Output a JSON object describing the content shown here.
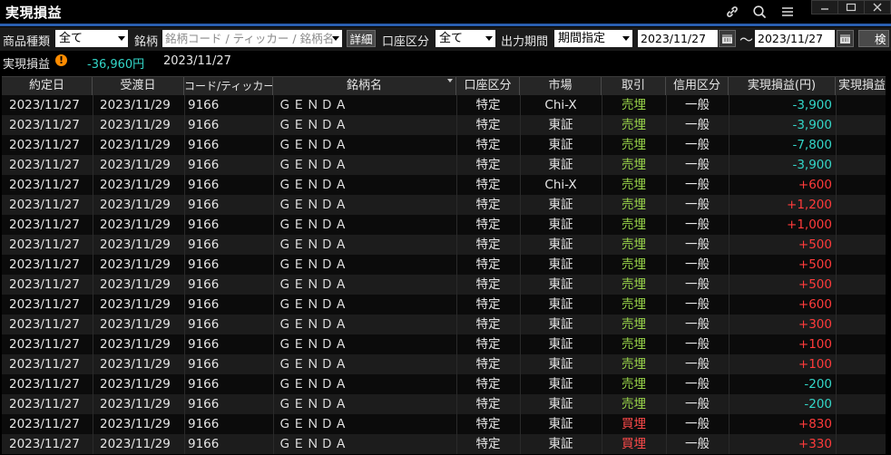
{
  "window": {
    "title": "実現損益"
  },
  "filters": {
    "product_type_label": "商品種類",
    "product_type_value": "全て",
    "symbol_label": "銘柄",
    "symbol_placeholder": "銘柄コード / ティッカー / 銘柄名",
    "detail_button": "詳細",
    "account_type_label": "口座区分",
    "account_type_value": "全て",
    "period_label": "出力期間",
    "period_value": "期間指定",
    "date_from": "2023/11/27",
    "date_sep": "〜",
    "date_to": "2023/11/27",
    "search_button": "検"
  },
  "summary": {
    "label": "実現損益",
    "warning_icon": "!",
    "value": "-36,960円",
    "date": "2023/11/27"
  },
  "table": {
    "columns": [
      "約定日",
      "受渡日",
      "コード/ティッカー",
      "銘柄名",
      "口座区分",
      "市場",
      "取引",
      "信用区分",
      "実現損益(円)",
      "実現損益"
    ],
    "rows": [
      {
        "trade_date": "2023/11/27",
        "settle_date": "2023/11/29",
        "code": "9166",
        "name": "ＧＥＮＤＡ",
        "account": "特定",
        "market": "Chi-X",
        "trade": "売埋",
        "margin": "一般",
        "pnl": "-3,900"
      },
      {
        "trade_date": "2023/11/27",
        "settle_date": "2023/11/29",
        "code": "9166",
        "name": "ＧＥＮＤＡ",
        "account": "特定",
        "market": "東証",
        "trade": "売埋",
        "margin": "一般",
        "pnl": "-3,900"
      },
      {
        "trade_date": "2023/11/27",
        "settle_date": "2023/11/29",
        "code": "9166",
        "name": "ＧＥＮＤＡ",
        "account": "特定",
        "market": "東証",
        "trade": "売埋",
        "margin": "一般",
        "pnl": "-7,800"
      },
      {
        "trade_date": "2023/11/27",
        "settle_date": "2023/11/29",
        "code": "9166",
        "name": "ＧＥＮＤＡ",
        "account": "特定",
        "market": "東証",
        "trade": "売埋",
        "margin": "一般",
        "pnl": "-3,900"
      },
      {
        "trade_date": "2023/11/27",
        "settle_date": "2023/11/29",
        "code": "9166",
        "name": "ＧＥＮＤＡ",
        "account": "特定",
        "market": "Chi-X",
        "trade": "売埋",
        "margin": "一般",
        "pnl": "+600"
      },
      {
        "trade_date": "2023/11/27",
        "settle_date": "2023/11/29",
        "code": "9166",
        "name": "ＧＥＮＤＡ",
        "account": "特定",
        "market": "東証",
        "trade": "売埋",
        "margin": "一般",
        "pnl": "+1,200"
      },
      {
        "trade_date": "2023/11/27",
        "settle_date": "2023/11/29",
        "code": "9166",
        "name": "ＧＥＮＤＡ",
        "account": "特定",
        "market": "東証",
        "trade": "売埋",
        "margin": "一般",
        "pnl": "+1,000"
      },
      {
        "trade_date": "2023/11/27",
        "settle_date": "2023/11/29",
        "code": "9166",
        "name": "ＧＥＮＤＡ",
        "account": "特定",
        "market": "東証",
        "trade": "売埋",
        "margin": "一般",
        "pnl": "+500"
      },
      {
        "trade_date": "2023/11/27",
        "settle_date": "2023/11/29",
        "code": "9166",
        "name": "ＧＥＮＤＡ",
        "account": "特定",
        "market": "東証",
        "trade": "売埋",
        "margin": "一般",
        "pnl": "+500"
      },
      {
        "trade_date": "2023/11/27",
        "settle_date": "2023/11/29",
        "code": "9166",
        "name": "ＧＥＮＤＡ",
        "account": "特定",
        "market": "東証",
        "trade": "売埋",
        "margin": "一般",
        "pnl": "+500"
      },
      {
        "trade_date": "2023/11/27",
        "settle_date": "2023/11/29",
        "code": "9166",
        "name": "ＧＥＮＤＡ",
        "account": "特定",
        "market": "東証",
        "trade": "売埋",
        "margin": "一般",
        "pnl": "+600"
      },
      {
        "trade_date": "2023/11/27",
        "settle_date": "2023/11/29",
        "code": "9166",
        "name": "ＧＥＮＤＡ",
        "account": "特定",
        "market": "東証",
        "trade": "売埋",
        "margin": "一般",
        "pnl": "+300"
      },
      {
        "trade_date": "2023/11/27",
        "settle_date": "2023/11/29",
        "code": "9166",
        "name": "ＧＥＮＤＡ",
        "account": "特定",
        "market": "東証",
        "trade": "売埋",
        "margin": "一般",
        "pnl": "+100"
      },
      {
        "trade_date": "2023/11/27",
        "settle_date": "2023/11/29",
        "code": "9166",
        "name": "ＧＥＮＤＡ",
        "account": "特定",
        "market": "東証",
        "trade": "売埋",
        "margin": "一般",
        "pnl": "+100"
      },
      {
        "trade_date": "2023/11/27",
        "settle_date": "2023/11/29",
        "code": "9166",
        "name": "ＧＥＮＤＡ",
        "account": "特定",
        "market": "東証",
        "trade": "売埋",
        "margin": "一般",
        "pnl": "-200"
      },
      {
        "trade_date": "2023/11/27",
        "settle_date": "2023/11/29",
        "code": "9166",
        "name": "ＧＥＮＤＡ",
        "account": "特定",
        "market": "東証",
        "trade": "売埋",
        "margin": "一般",
        "pnl": "-200"
      },
      {
        "trade_date": "2023/11/27",
        "settle_date": "2023/11/29",
        "code": "9166",
        "name": "ＧＥＮＤＡ",
        "account": "特定",
        "market": "東証",
        "trade": "買埋",
        "margin": "一般",
        "pnl": "+830"
      },
      {
        "trade_date": "2023/11/27",
        "settle_date": "2023/11/29",
        "code": "9166",
        "name": "ＧＥＮＤＡ",
        "account": "特定",
        "market": "東証",
        "trade": "買埋",
        "margin": "一般",
        "pnl": "+330"
      }
    ]
  },
  "colors": {
    "positive": "#ff3b3b",
    "negative": "#33d6c8",
    "sell": "#9ad64a",
    "buy": "#ff4a4a",
    "warning": "#ff8c00",
    "summary_value": "#33d6c8"
  },
  "icons": {
    "link": "link-icon",
    "search": "search-icon",
    "menu": "menu-icon",
    "minimize": "minimize-icon",
    "maximize": "maximize-icon",
    "close": "close-icon",
    "calendar": "calendar-icon",
    "sort": "sort-arrow-icon"
  }
}
